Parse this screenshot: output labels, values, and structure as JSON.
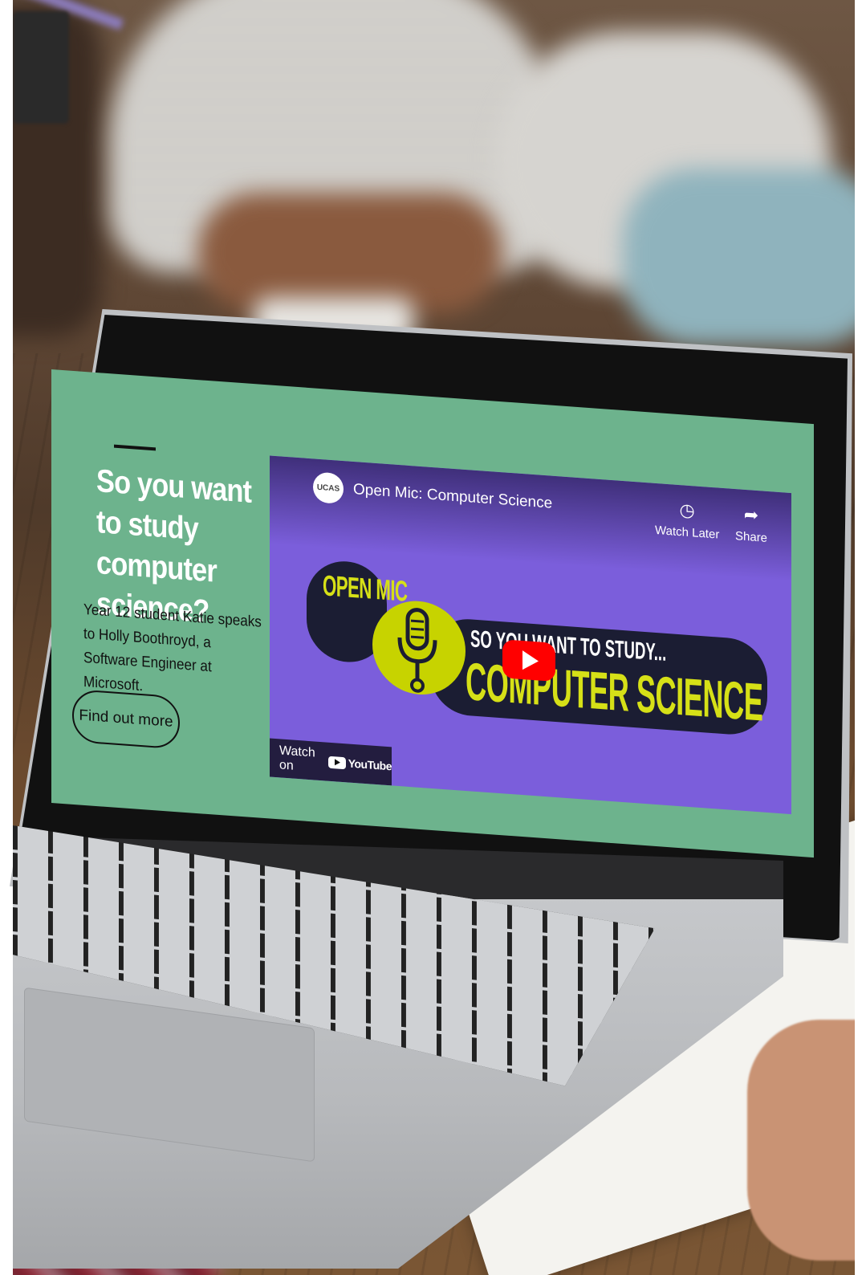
{
  "page": {
    "headline": "So you want to study computer science?",
    "description": "Year 12 student Katie speaks to Holly Boothroyd, a Software Engineer at Microsoft.",
    "cta_label": "Find out more"
  },
  "video": {
    "channel_logo_text": "UCAS",
    "title": "Open Mic: Computer Science",
    "watch_later_label": "Watch Later",
    "share_label": "Share",
    "thumbnail_badge": "OPEN MIC",
    "thumbnail_line1": "SO YOU WANT TO STUDY...",
    "thumbnail_line2": "COMPUTER SCIENCE",
    "watch_on_label": "Watch on",
    "youtube_label": "YouTube"
  },
  "icons": {
    "watch_later": "clock-icon",
    "share": "share-arrow-icon",
    "play": "play-icon",
    "logo": "youtube-logo-icon"
  },
  "colors": {
    "page_bg": "#6db38d",
    "video_bg": "#7b5edb",
    "accent_yellow": "#d6e017",
    "play_red": "#ff0000"
  }
}
